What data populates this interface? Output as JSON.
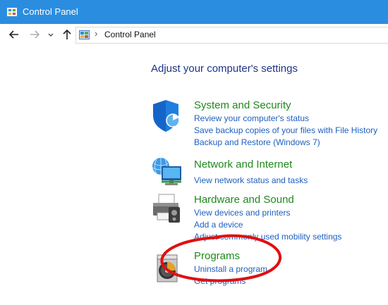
{
  "window": {
    "title": "Control Panel"
  },
  "navigation": {
    "back_icon": "arrow-left-icon",
    "forward_icon": "arrow-right-icon",
    "recent_icon": "chevron-down-icon",
    "up_icon": "arrow-up-icon"
  },
  "address": {
    "breadcrumb": "Control Panel",
    "separator": "›"
  },
  "main": {
    "heading": "Adjust your computer's settings",
    "categories": [
      {
        "title": "System and Security",
        "icon": "shield-icon",
        "links": [
          "Review your computer's status",
          "Save backup copies of your files with File History",
          "Backup and Restore (Windows 7)"
        ]
      },
      {
        "title": "Network and Internet",
        "icon": "globe-network-icon",
        "links": [
          "View network status and tasks"
        ]
      },
      {
        "title": "Hardware and Sound",
        "icon": "printer-icon",
        "links": [
          "View devices and printers",
          "Add a device",
          "Adjust commonly used mobility settings"
        ]
      },
      {
        "title": "Programs",
        "icon": "programs-disc-icon",
        "links": [
          "Uninstall a program",
          "Get programs"
        ]
      }
    ]
  },
  "colors": {
    "titlebar": "#2b8de0",
    "heading": "#1e3287",
    "category_title": "#1d8a1d",
    "link": "#1e5fc0",
    "annotation": "#e01010"
  }
}
